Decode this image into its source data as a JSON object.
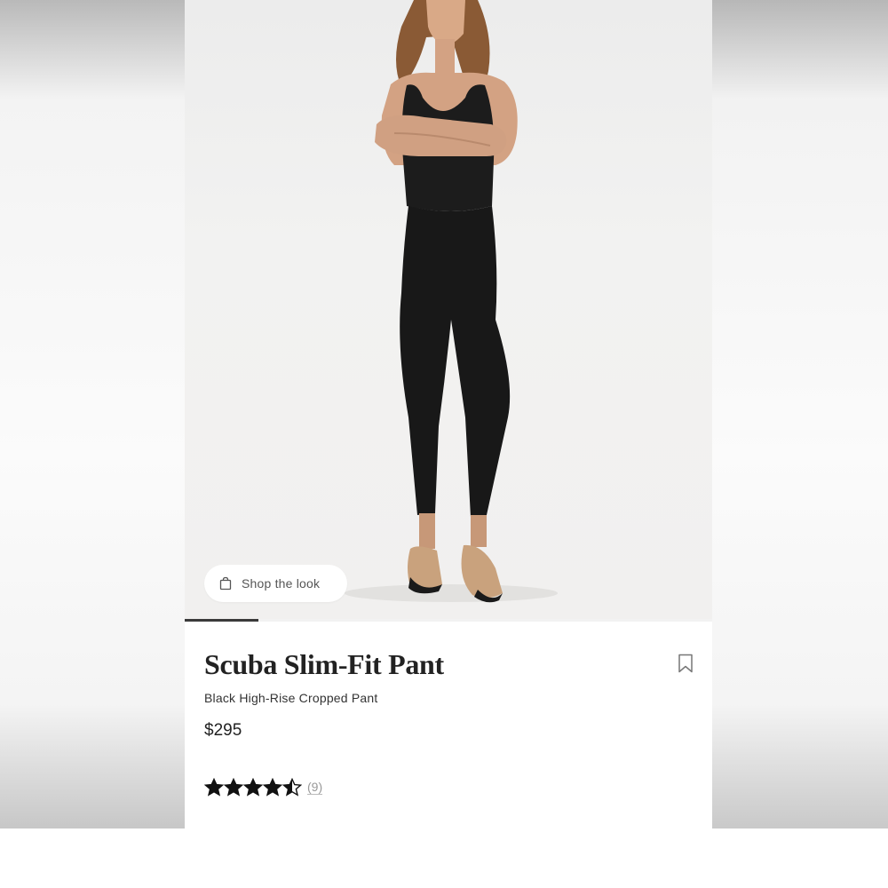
{
  "product": {
    "title": "Scuba Slim-Fit Pant",
    "subtitle": "Black High-Rise Cropped Pant",
    "price": "$295",
    "rating": 4.5,
    "review_count": "(9)"
  },
  "hero": {
    "shop_the_look_label": "Shop the look",
    "gallery_progress": 0.14
  },
  "icons": {
    "shop_bag": "shopping-bag-icon",
    "bookmark": "bookmark-icon",
    "star": "star-icon"
  },
  "colors": {
    "text_primary": "#222222",
    "text_muted": "#999999",
    "star": "#111111",
    "hero_bg": "#efefee"
  }
}
